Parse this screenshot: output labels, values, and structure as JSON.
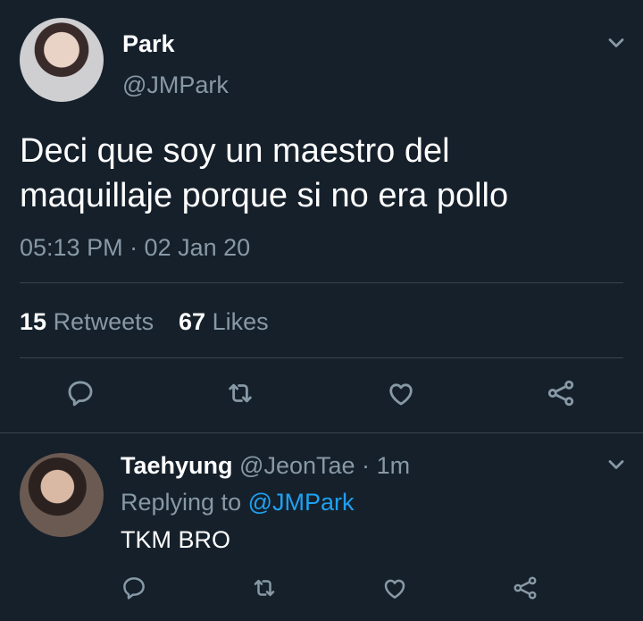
{
  "tweet": {
    "display_name": "Park",
    "handle": "@JMPark",
    "text_line1": "Deci que soy un maestro del",
    "text_line2": "maquillaje porque si no era pollo",
    "timestamp": "05:13 PM · 02 Jan 20",
    "retweets_count": "15",
    "retweets_label": "Retweets",
    "likes_count": "67",
    "likes_label": "Likes"
  },
  "reply": {
    "display_name": "Taehyung",
    "handle": "@JeonTae",
    "separator": "·",
    "time": "1m",
    "replying_prefix": "Replying to",
    "replying_handle": "@JMPark",
    "text": "TKM BRO"
  },
  "icons": {
    "reply": "reply-icon",
    "retweet": "retweet-icon",
    "like": "like-icon",
    "share": "share-icon",
    "more": "chevron-down-icon"
  },
  "colors": {
    "background": "#15202b",
    "muted": "#8899a6",
    "link": "#1da1f2",
    "divider": "#38444d"
  }
}
